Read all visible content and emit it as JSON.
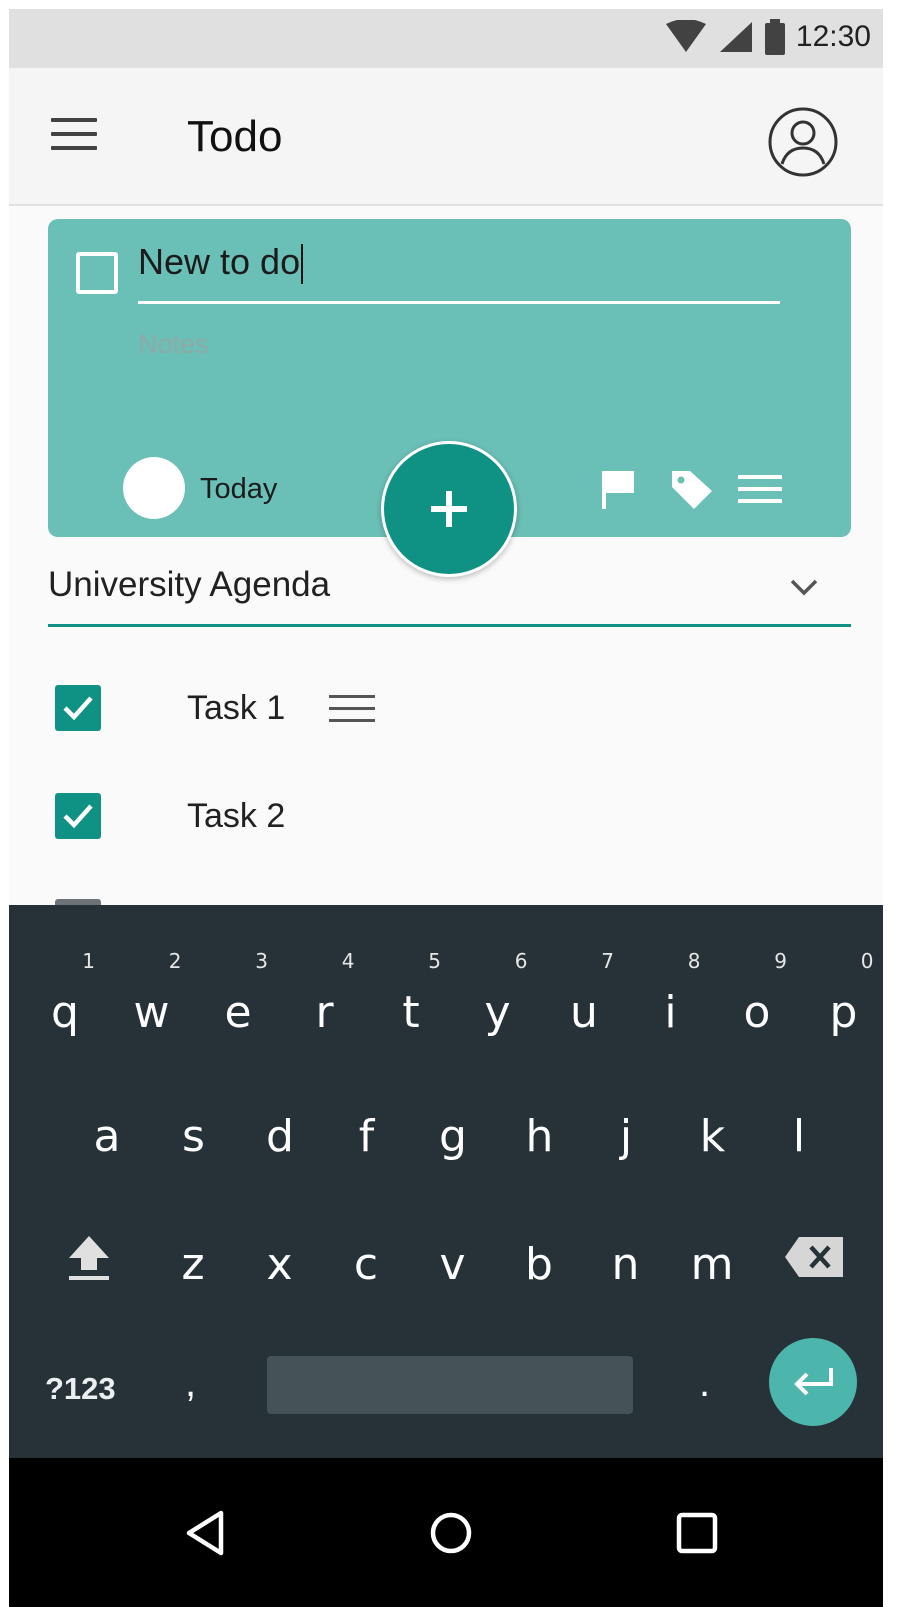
{
  "status_bar": {
    "time": "12:30"
  },
  "app_bar": {
    "title": "Todo"
  },
  "new_todo": {
    "title_value": "New to do",
    "notes_placeholder": "Notes",
    "date_label": "Today"
  },
  "list_selector": {
    "selected": "University Agenda"
  },
  "tasks": [
    {
      "label": "Task 1",
      "checked": true
    },
    {
      "label": "Task 2",
      "checked": true
    }
  ],
  "keyboard": {
    "row1": [
      "q",
      "w",
      "e",
      "r",
      "t",
      "y",
      "u",
      "i",
      "o",
      "p"
    ],
    "row1_hints": [
      "1",
      "2",
      "3",
      "4",
      "5",
      "6",
      "7",
      "8",
      "9",
      "0"
    ],
    "row2": [
      "a",
      "s",
      "d",
      "f",
      "g",
      "h",
      "j",
      "k",
      "l"
    ],
    "row3": [
      "z",
      "x",
      "c",
      "v",
      "b",
      "n",
      "m"
    ],
    "symbols_label": "?123",
    "comma": ",",
    "period": "."
  },
  "colors": {
    "accent": "#0f9283",
    "card": "#6abfb6",
    "keyboard_bg": "#263238",
    "enter_key": "#4db6ac"
  }
}
